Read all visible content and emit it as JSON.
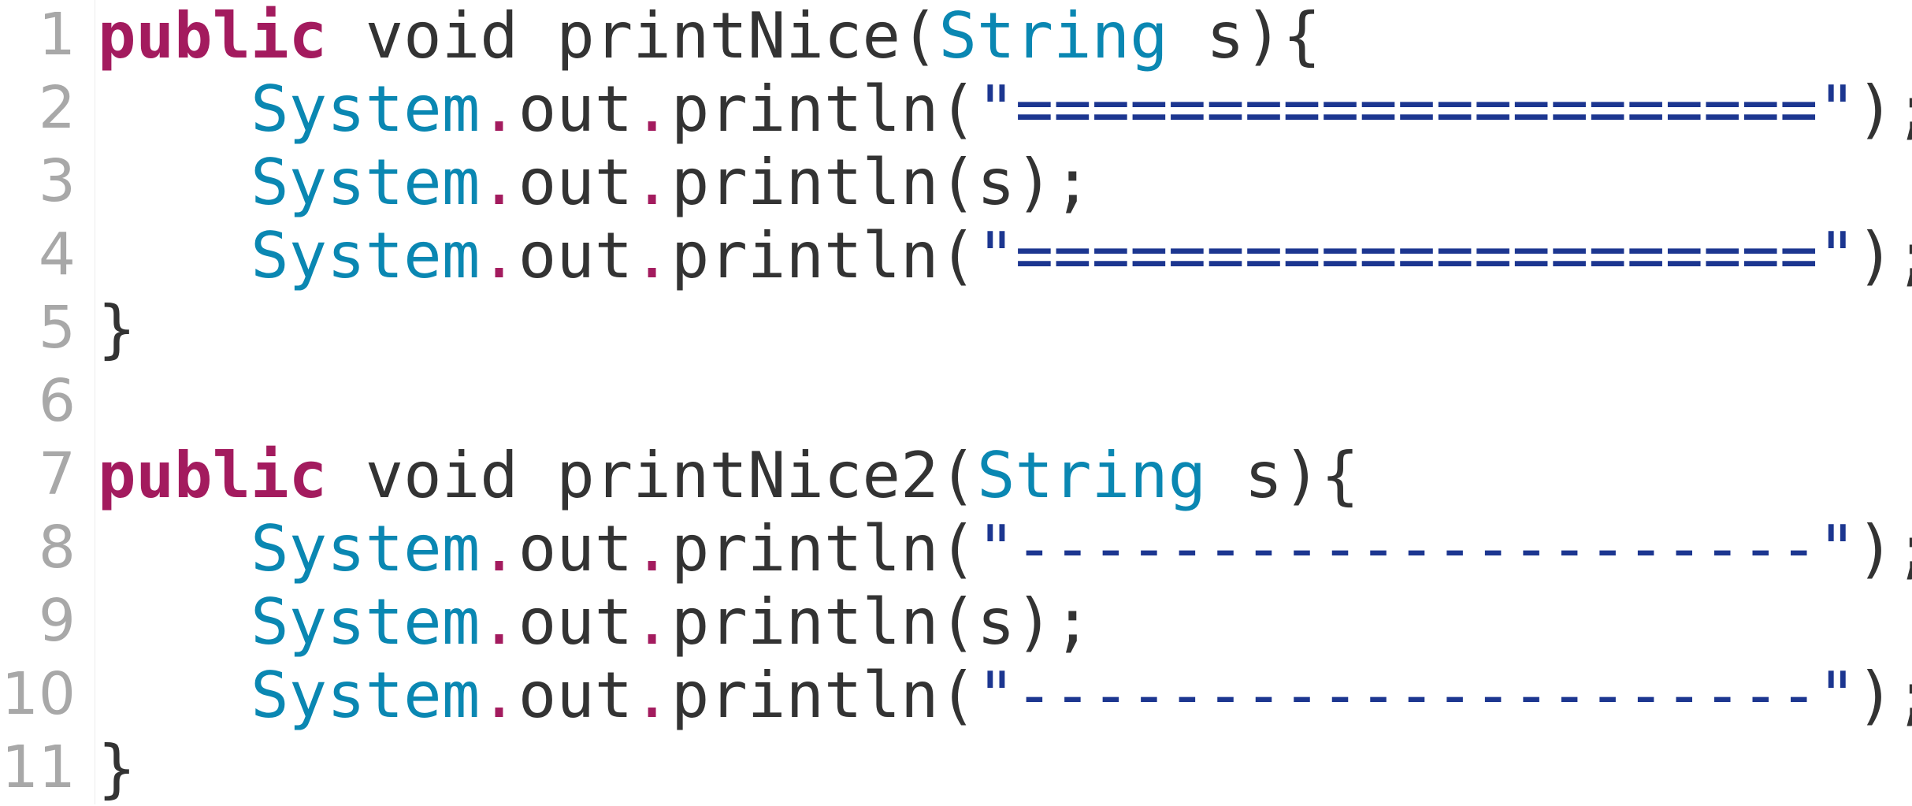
{
  "editor": {
    "language": "java",
    "colors": {
      "keyword": "#a31b5e",
      "type": "#0a87b2",
      "dot": "#a31b5e",
      "string": "#1c3690",
      "plain": "#333333",
      "line_number": "#a8a8a8"
    },
    "lines": [
      {
        "number": "1",
        "tokens": [
          {
            "t": "kw",
            "v": "public"
          },
          {
            "t": "plain",
            "v": " void printNice("
          },
          {
            "t": "type",
            "v": "String"
          },
          {
            "t": "plain",
            "v": " s){"
          }
        ]
      },
      {
        "number": "2",
        "tokens": [
          {
            "t": "plain",
            "v": "    "
          },
          {
            "t": "type",
            "v": "System"
          },
          {
            "t": "dot",
            "v": "."
          },
          {
            "t": "plain",
            "v": "out"
          },
          {
            "t": "dot",
            "v": "."
          },
          {
            "t": "plain",
            "v": "println("
          },
          {
            "t": "str",
            "v": "\"=====================\""
          },
          {
            "t": "plain",
            "v": ");"
          }
        ]
      },
      {
        "number": "3",
        "tokens": [
          {
            "t": "plain",
            "v": "    "
          },
          {
            "t": "type",
            "v": "System"
          },
          {
            "t": "dot",
            "v": "."
          },
          {
            "t": "plain",
            "v": "out"
          },
          {
            "t": "dot",
            "v": "."
          },
          {
            "t": "plain",
            "v": "println(s);"
          }
        ]
      },
      {
        "number": "4",
        "tokens": [
          {
            "t": "plain",
            "v": "    "
          },
          {
            "t": "type",
            "v": "System"
          },
          {
            "t": "dot",
            "v": "."
          },
          {
            "t": "plain",
            "v": "out"
          },
          {
            "t": "dot",
            "v": "."
          },
          {
            "t": "plain",
            "v": "println("
          },
          {
            "t": "str",
            "v": "\"=====================\""
          },
          {
            "t": "plain",
            "v": ");"
          }
        ]
      },
      {
        "number": "5",
        "tokens": [
          {
            "t": "plain",
            "v": "}"
          }
        ]
      },
      {
        "number": "6",
        "tokens": []
      },
      {
        "number": "7",
        "tokens": [
          {
            "t": "kw",
            "v": "public"
          },
          {
            "t": "plain",
            "v": " void printNice2("
          },
          {
            "t": "type",
            "v": "String"
          },
          {
            "t": "plain",
            "v": " s){"
          }
        ]
      },
      {
        "number": "8",
        "tokens": [
          {
            "t": "plain",
            "v": "    "
          },
          {
            "t": "type",
            "v": "System"
          },
          {
            "t": "dot",
            "v": "."
          },
          {
            "t": "plain",
            "v": "out"
          },
          {
            "t": "dot",
            "v": "."
          },
          {
            "t": "plain",
            "v": "println("
          },
          {
            "t": "str",
            "v": "\"---------------------\""
          },
          {
            "t": "plain",
            "v": ");"
          }
        ]
      },
      {
        "number": "9",
        "tokens": [
          {
            "t": "plain",
            "v": "    "
          },
          {
            "t": "type",
            "v": "System"
          },
          {
            "t": "dot",
            "v": "."
          },
          {
            "t": "plain",
            "v": "out"
          },
          {
            "t": "dot",
            "v": "."
          },
          {
            "t": "plain",
            "v": "println(s);"
          }
        ]
      },
      {
        "number": "10",
        "tokens": [
          {
            "t": "plain",
            "v": "    "
          },
          {
            "t": "type",
            "v": "System"
          },
          {
            "t": "dot",
            "v": "."
          },
          {
            "t": "plain",
            "v": "out"
          },
          {
            "t": "dot",
            "v": "."
          },
          {
            "t": "plain",
            "v": "println("
          },
          {
            "t": "str",
            "v": "\"---------------------\""
          },
          {
            "t": "plain",
            "v": ");"
          }
        ]
      },
      {
        "number": "11",
        "tokens": [
          {
            "t": "plain",
            "v": "}"
          }
        ]
      }
    ]
  }
}
